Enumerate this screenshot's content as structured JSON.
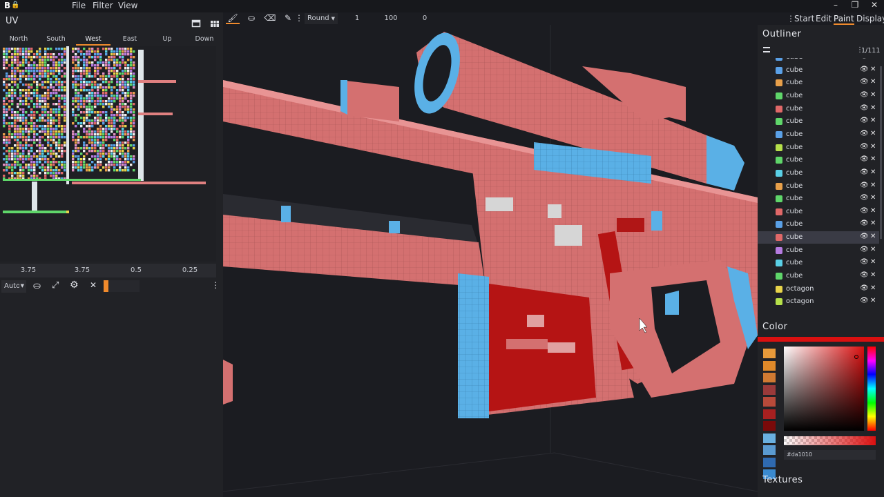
{
  "app": {
    "logo": "B",
    "menus": [
      "File",
      "Filter",
      "View"
    ]
  },
  "uv_panel": {
    "title": "UV",
    "faces": [
      "North",
      "South",
      "West",
      "East",
      "Up",
      "Down"
    ],
    "active_face": "West",
    "values": [
      "3.75",
      "3.75",
      "0.5",
      "0.25"
    ],
    "auto_label": "Auto"
  },
  "paint_toolbar": {
    "brush_shape": "Round",
    "values": [
      "1",
      "100",
      "0"
    ]
  },
  "modes": [
    "Start",
    "Edit",
    "Paint",
    "Display"
  ],
  "active_mode": "Paint",
  "outliner": {
    "title": "Outliner",
    "count": "1/111",
    "items": [
      {
        "name": "cube",
        "color": "#5aa0e6",
        "selected": false
      },
      {
        "name": "cube",
        "color": "#5aa0e6",
        "selected": false
      },
      {
        "name": "cube",
        "color": "#e8a04a",
        "selected": false
      },
      {
        "name": "cube",
        "color": "#5fd66a",
        "selected": false
      },
      {
        "name": "cube",
        "color": "#e06868",
        "selected": false
      },
      {
        "name": "cube",
        "color": "#5fd66a",
        "selected": false
      },
      {
        "name": "cube",
        "color": "#5aa0e6",
        "selected": false
      },
      {
        "name": "cube",
        "color": "#b6e04a",
        "selected": false
      },
      {
        "name": "cube",
        "color": "#5fd66a",
        "selected": false
      },
      {
        "name": "cube",
        "color": "#5ad0e6",
        "selected": false
      },
      {
        "name": "cube",
        "color": "#e8a04a",
        "selected": false
      },
      {
        "name": "cube",
        "color": "#5fd66a",
        "selected": false
      },
      {
        "name": "cube",
        "color": "#e06868",
        "selected": false
      },
      {
        "name": "cube",
        "color": "#5aa0e6",
        "selected": false
      },
      {
        "name": "cube",
        "color": "#e06868",
        "selected": true
      },
      {
        "name": "cube",
        "color": "#b57be0",
        "selected": false
      },
      {
        "name": "cube",
        "color": "#5ad0e6",
        "selected": false
      },
      {
        "name": "cube",
        "color": "#5fd66a",
        "selected": false
      },
      {
        "name": "octagon",
        "color": "#e8d44a",
        "selected": false
      },
      {
        "name": "octagon",
        "color": "#b6e04a",
        "selected": false
      }
    ]
  },
  "color_panel": {
    "title": "Color",
    "current": "#da1010",
    "hex_value": "#da1010",
    "palette": [
      "#e89a3a",
      "#e08a2a",
      "#d07a32",
      "#9a3a3a",
      "#b84a3a",
      "#a82020",
      "#7a0a0a",
      "#6ab0e0",
      "#5a9ad0",
      "#2f6ab0",
      "#3a8ad0"
    ]
  },
  "textures_panel": {
    "title": "Textures"
  }
}
